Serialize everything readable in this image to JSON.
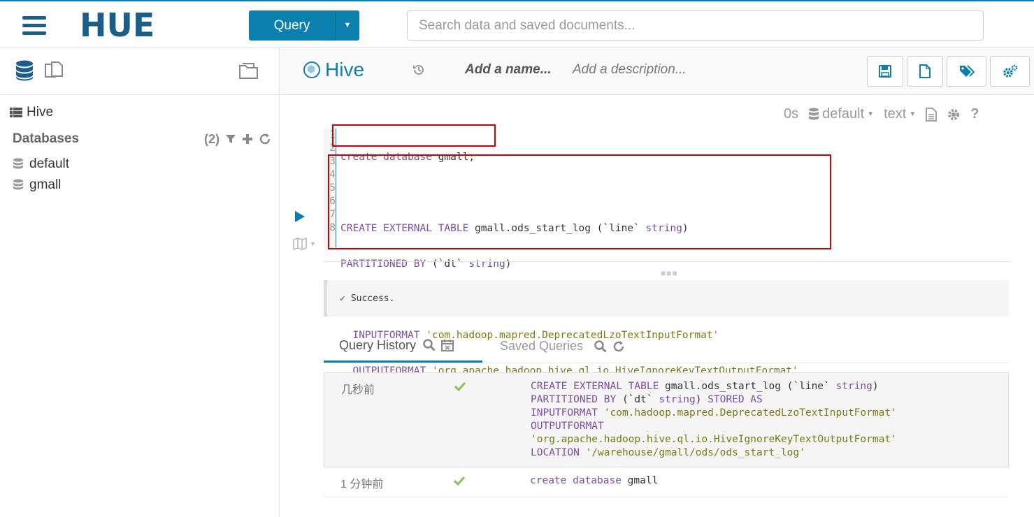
{
  "topbar": {
    "logo_text": "HUE",
    "query_button_label": "Query",
    "search_placeholder": "Search data and saved documents..."
  },
  "left": {
    "root_label": "Hive",
    "databases_title": "Databases",
    "databases_count": "(2)",
    "databases": [
      "default",
      "gmall"
    ]
  },
  "editor_header": {
    "type_label": "Hive",
    "name_placeholder": "Add a name...",
    "description_placeholder": "Add a description..."
  },
  "snippet": {
    "time": "0s",
    "database": "default",
    "format": "text"
  },
  "editor": {
    "line_numbers": [
      "1",
      "2",
      "3",
      "4",
      "5",
      "6",
      "7",
      "8"
    ]
  },
  "status": {
    "message": "Success."
  },
  "tabs": {
    "history": "Query History",
    "saved": "Saved Queries"
  },
  "history": [
    {
      "time": "几秒前",
      "status": "success"
    },
    {
      "time": "1 分钟前",
      "status": "success"
    }
  ],
  "colors": {
    "brand": "#0B7FAD",
    "success": "#8CC152",
    "highlight_box": "#CC0000",
    "keyword": "#7B4FA0",
    "string": "#7A7A14"
  },
  "icons": [
    "hamburger-icon",
    "database-icon",
    "documents-icon",
    "folder-icon",
    "table-icon",
    "filter-icon",
    "plus-icon",
    "refresh-icon",
    "hive-icon",
    "history-icon",
    "save-icon",
    "new-document-icon",
    "tags-icon",
    "settings-icon",
    "file-icon",
    "gear-icon",
    "question-icon",
    "play-icon",
    "map-icon",
    "check-icon",
    "search-icon",
    "calendar-icon"
  ]
}
